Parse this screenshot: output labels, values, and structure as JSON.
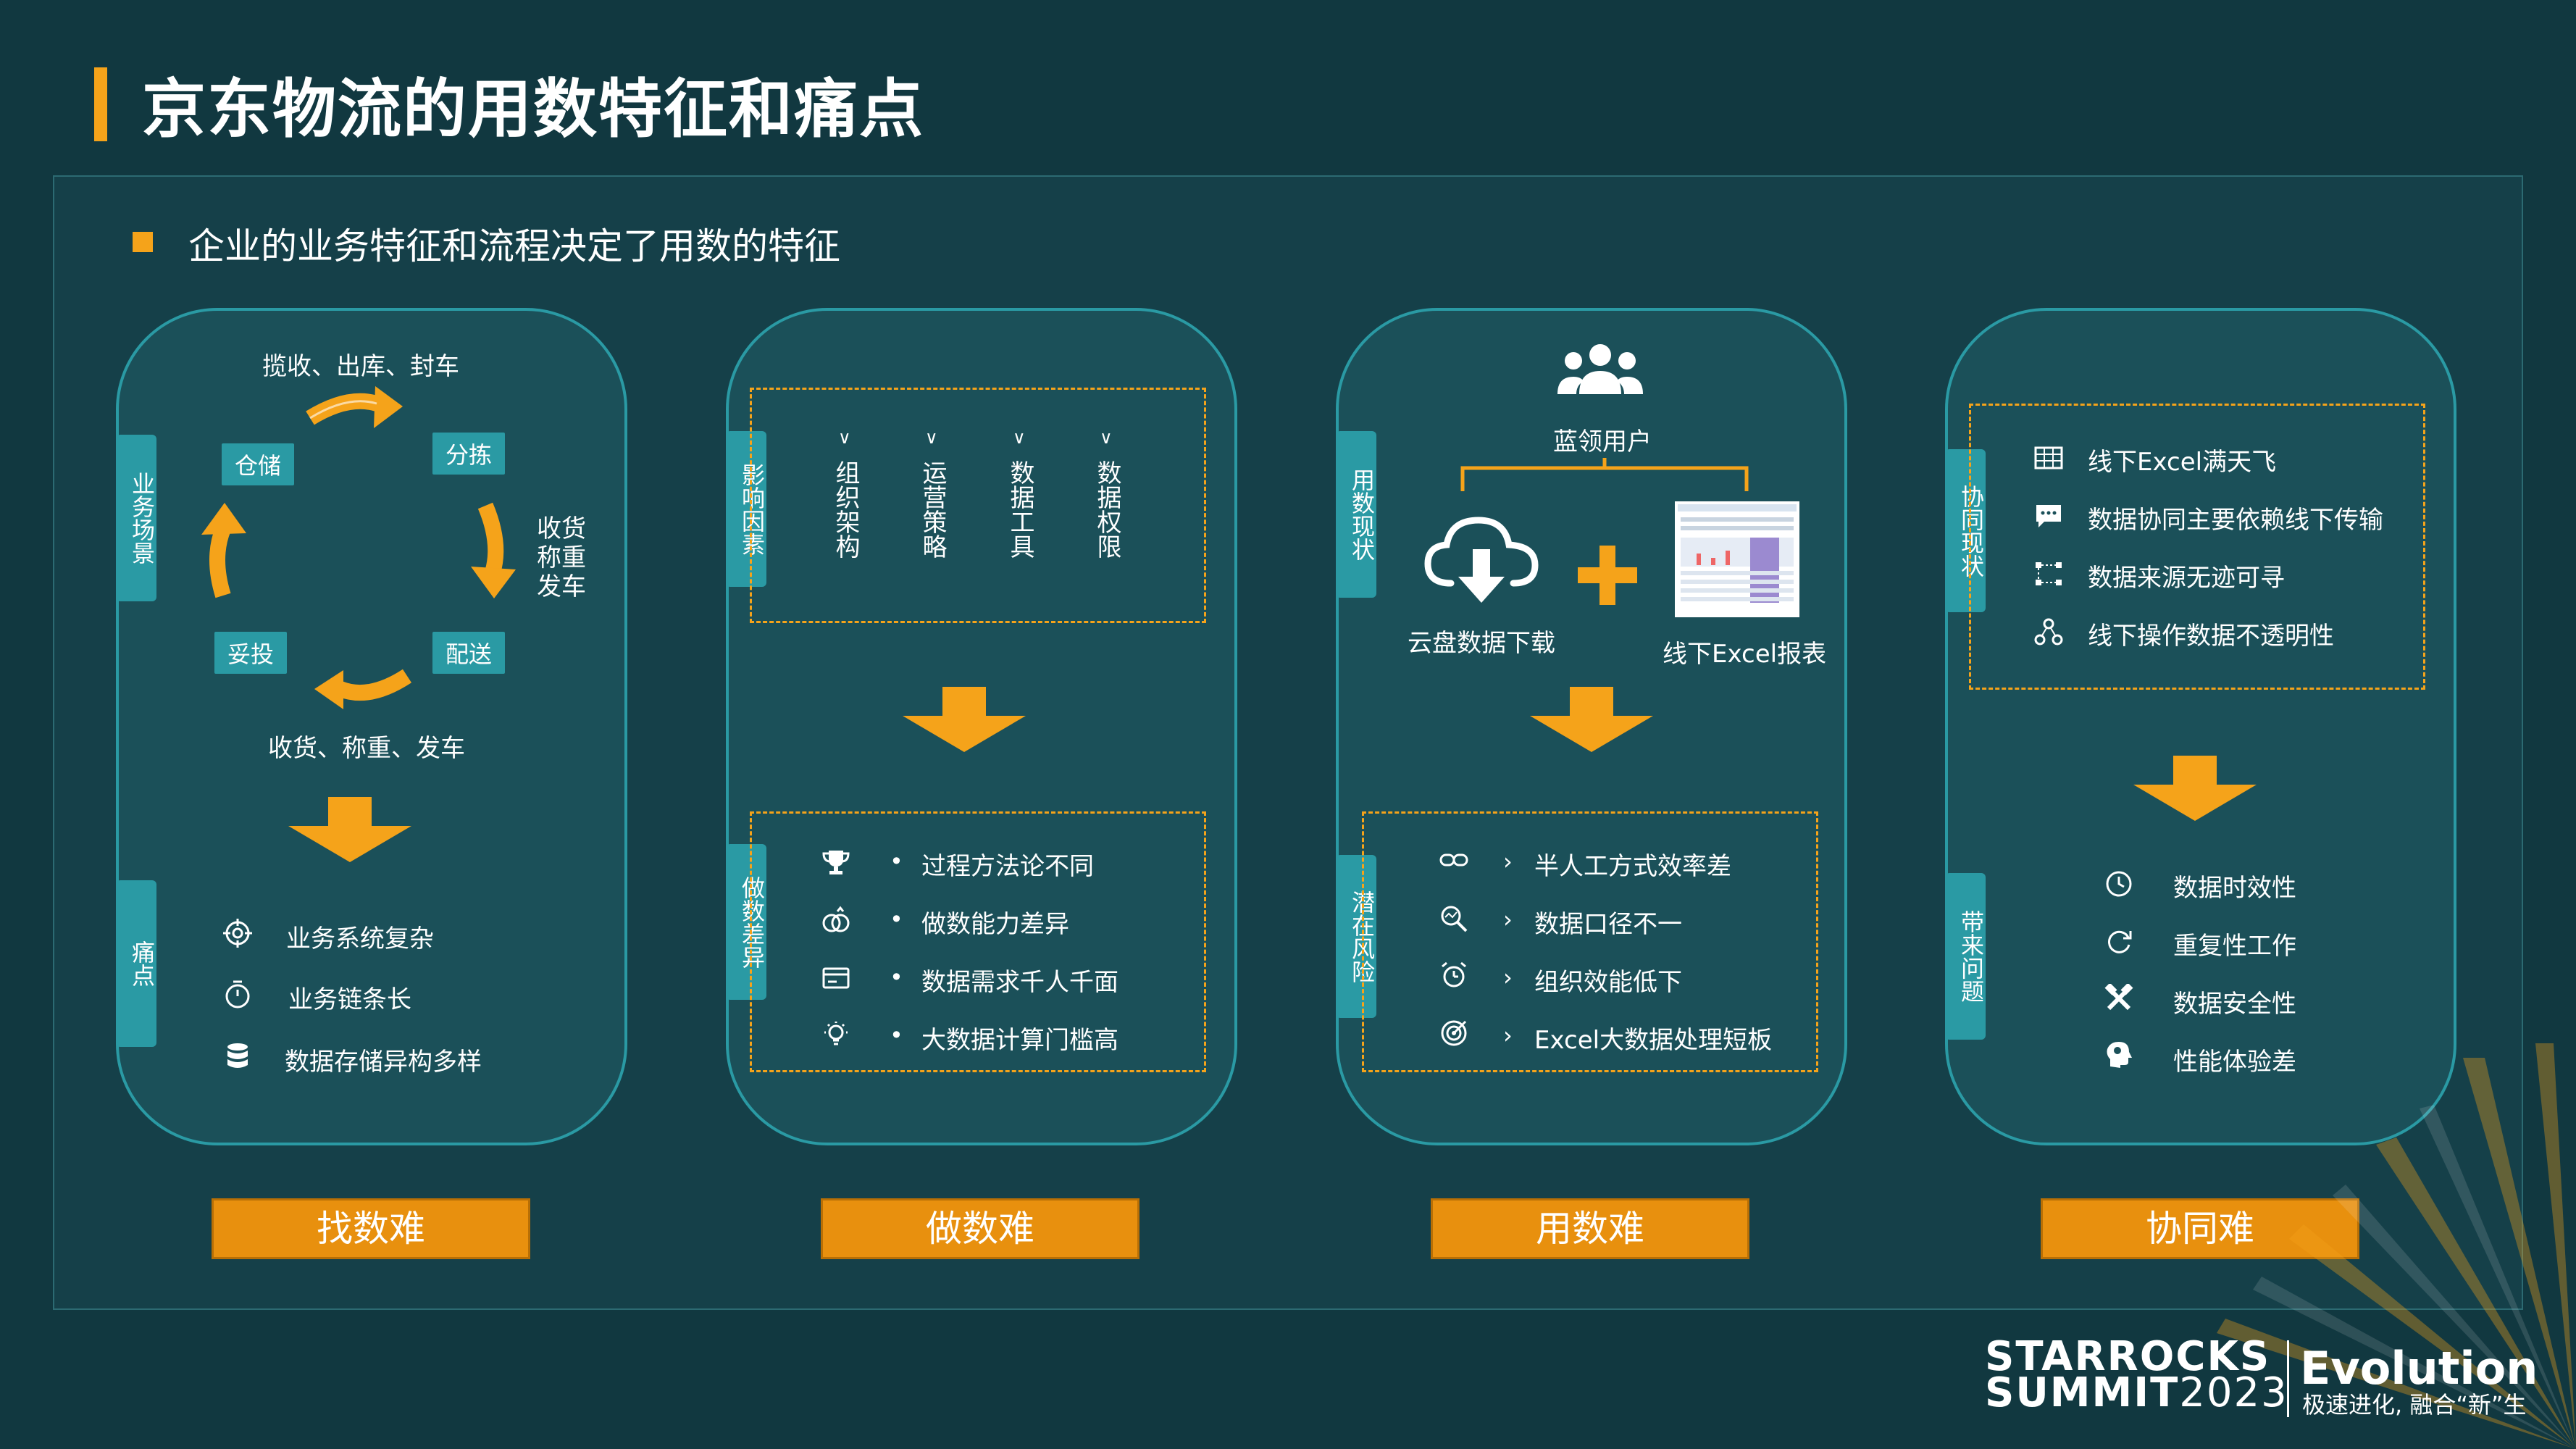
{
  "title": "京东物流的用数特征和痛点",
  "subtitle": "企业的业务特征和流程决定了用数的特征",
  "panel1": {
    "tab_top": "业务场景",
    "tab_bottom": "痛点",
    "cycle_top": "揽收、出库、封车",
    "chip_warehouse": "仓储",
    "chip_sort": "分拣",
    "right_text_1": "收货",
    "right_text_2": "称重",
    "right_text_3": "发车",
    "chip_deliver": "配送",
    "chip_dispatch": "妥投",
    "cycle_bottom": "收货、称重、发车",
    "pains": [
      "业务系统复杂",
      "业务链条长",
      "数据存储异构多样"
    ]
  },
  "panel2": {
    "tab_top": "影响因素",
    "tab_bottom": "做数差异",
    "factors": [
      "组织架构",
      "运营策略",
      "数据工具",
      "数据权限"
    ],
    "bullets": [
      "过程方法论不同",
      "做数能力差异",
      "数据需求千人千面",
      "大数据计算门槛高"
    ],
    "bullet_marker": "•"
  },
  "panel3": {
    "tab_top": "用数现状",
    "tab_bottom": "潜在风险",
    "users_label": "蓝领用户",
    "cloud_label": "云盘数据下载",
    "excel_label": "线下Excel报表",
    "risks": [
      "半人工方式效率差",
      "数据口径不一",
      "组织效能低下",
      "Excel大数据处理短板"
    ]
  },
  "panel4": {
    "tab_top": "协同现状",
    "tab_bottom": "带来问题",
    "status": [
      "线下Excel满天飞",
      "数据协同主要依赖线下传输",
      "数据来源无迹可寻",
      "线下操作数据不透明性"
    ],
    "problems": [
      "数据时效性",
      "重复性工作",
      "数据安全性",
      "性能体验差"
    ]
  },
  "buttons": [
    "找数难",
    "做数难",
    "用数难",
    "协同难"
  ],
  "logo": {
    "line1": "STARROCKS",
    "line2a": "SUMMIT",
    "line2b": "2023",
    "evo": "Evolution",
    "slogan": "极速进化, 融合“新”生"
  },
  "colors": {
    "accent": "#f5a31a",
    "teal": "#2a9aa4",
    "bg": "#113840"
  }
}
